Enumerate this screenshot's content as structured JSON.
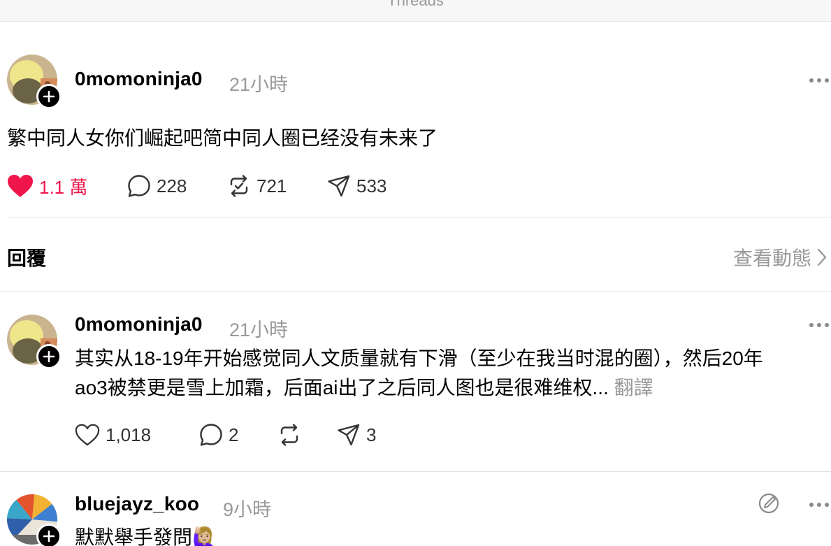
{
  "topbar": {
    "title": "Threads"
  },
  "post": {
    "username": "0momoninja0",
    "time": "21小時",
    "text": "繁中同人女你们崛起吧简中同人圈已经没有未来了",
    "likes": "1.1 萬",
    "comments": "228",
    "reposts": "721",
    "shares": "533"
  },
  "replies_header": {
    "label": "回覆",
    "view_activity": "查看動態"
  },
  "replies": [
    {
      "username": "0momoninja0",
      "time": "21小時",
      "line1": "其实从18-19年开始感觉同人文质量就有下滑（至少在我当时混的圈），然后20年",
      "line2": "ao3被禁更是雪上加霜，后面ai出了之后同人图也是很难维权...",
      "translate": "翻譯",
      "likes": "1,018",
      "comments": "2",
      "reposts": "",
      "shares": "3"
    },
    {
      "username": "bluejayz_koo",
      "time": "9小時",
      "text": "默默舉手發問🙋🏼‍♀️"
    }
  ],
  "icons": {
    "heart": "heart-icon",
    "comment": "comment-icon",
    "repost": "repost-icon",
    "share": "share-icon",
    "more": "more-icon",
    "follow": "plus-icon",
    "edit": "edit-icon",
    "chevron": "chevron-right-icon"
  },
  "colors": {
    "like": "#f0154a",
    "muted": "#999999",
    "divider": "#e2e2e2"
  }
}
